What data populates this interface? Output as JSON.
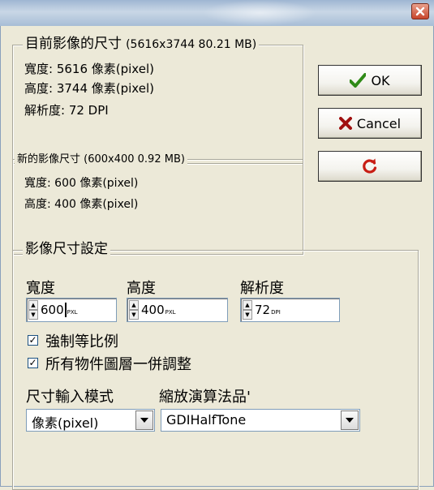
{
  "window": {
    "close_icon": "close-icon"
  },
  "original_size": {
    "legend": "目前影像的尺寸",
    "summary": "(5616x3744  80.21 MB)",
    "width_line": "寬度: 5616 像素(pixel)",
    "height_line": "高度: 3744 像素(pixel)",
    "resolution_line": "解析度: 72 DPI"
  },
  "new_size": {
    "legend": "新的影像尺寸 (600x400  0.92 MB)",
    "width_line": "寬度: 600 像素(pixel)",
    "height_line": "高度: 400 像素(pixel)"
  },
  "buttons": {
    "ok_label": "OK",
    "cancel_label": "Cancel",
    "ok_icon": "checkmark-icon",
    "cancel_icon": "x-icon",
    "reset_icon": "refresh-icon"
  },
  "settings": {
    "legend": "影像尺寸設定",
    "width_label": "寬度",
    "height_label": "高度",
    "resolution_label": "解析度",
    "width_value": "600",
    "width_unit": "PXL",
    "height_value": "400",
    "height_unit": "PXL",
    "resolution_value": "72",
    "resolution_unit": "DPI",
    "keep_ratio_label": "強制等比例",
    "keep_ratio_checked": true,
    "all_layers_label": "所有物件圖層一併調整",
    "all_layers_checked": true,
    "input_mode_label": "尺寸輸入模式",
    "input_mode_value": "像素(pixel)",
    "algorithm_label": "縮放演算法品'",
    "algorithm_value": "GDIHalfTone"
  },
  "colors": {
    "check_green": "#2f8a17",
    "cancel_red": "#a01010",
    "reset_red": "#c81d14"
  }
}
